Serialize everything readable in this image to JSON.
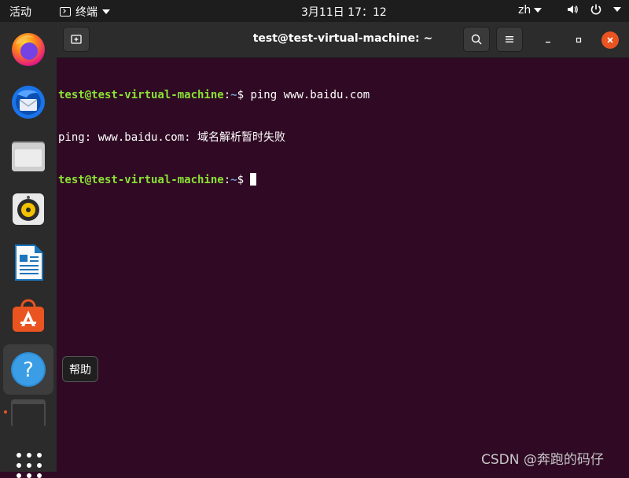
{
  "topbar": {
    "activities": "活动",
    "app_name": "终端",
    "clock": "3月11日  17：12",
    "lang": "zh"
  },
  "dock": {
    "items": [
      {
        "name": "firefox",
        "icon": "firefox-icon"
      },
      {
        "name": "thunderbird",
        "icon": "thunderbird-mail-icon"
      },
      {
        "name": "files",
        "icon": "files-folder-icon"
      },
      {
        "name": "rhythmbox",
        "icon": "rhythmbox-speaker-icon"
      },
      {
        "name": "libreoffice-writer",
        "icon": "writer-document-icon"
      },
      {
        "name": "ubuntu-software",
        "icon": "software-store-icon"
      },
      {
        "name": "help",
        "icon": "help-icon",
        "active": true
      },
      {
        "name": "terminal",
        "icon": "terminal-icon"
      }
    ],
    "tooltip": "帮助"
  },
  "window": {
    "title": "test@test-virtual-machine: ~"
  },
  "terminal": {
    "lines": [
      {
        "user": "test@test-virtual-machine",
        "sep": ":",
        "path": "~",
        "symbol": "$ ",
        "command": "ping www.baidu.com"
      },
      {
        "output": "ping: www.baidu.com: 域名解析暂时失败"
      },
      {
        "user": "test@test-virtual-machine",
        "sep": ":",
        "path": "~",
        "symbol": "$ ",
        "command": ""
      }
    ]
  },
  "colors": {
    "terminal_bg": "#300a24",
    "prompt_user": "#8ae234",
    "prompt_path": "#729fcf",
    "accent": "#e95420"
  },
  "watermark": "CSDN @奔跑的码仔"
}
